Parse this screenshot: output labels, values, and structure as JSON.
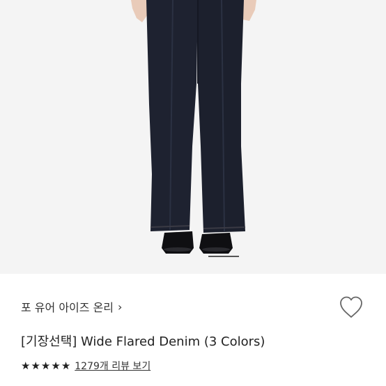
{
  "brand": {
    "name": "포 유어 아이즈 온리",
    "chevron": "›"
  },
  "product": {
    "title": "[기장선택] Wide Flared Denim (3 Colors)"
  },
  "rating": {
    "stars": 5,
    "reviews_link": "1279개 리뷰 보기"
  },
  "icons": {
    "wishlist": "heart-outline-icon",
    "star": "star-icon"
  },
  "colors": {
    "background": "#ffffff",
    "photo_bg": "#f4f4f4",
    "denim": "#1e2230",
    "text": "#222222"
  },
  "gallery": {
    "current_slide_indicator": "active"
  }
}
